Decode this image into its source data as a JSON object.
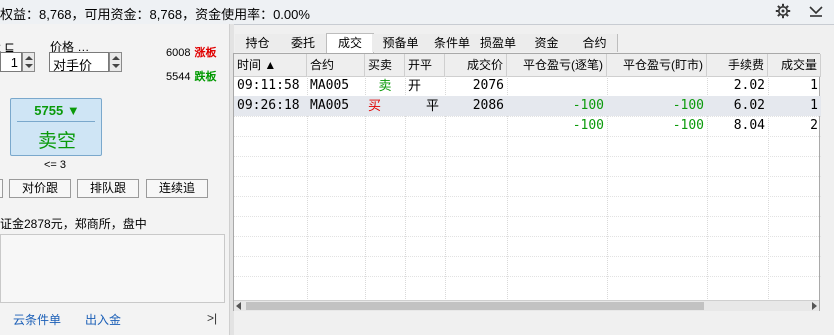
{
  "header": {
    "summary": "权益：8,768，可用资金：8,768，资金使用率：0.00%"
  },
  "order_panel": {
    "qty_label": "量 ⊑",
    "qty_value": "1",
    "price_label": "价格 …",
    "price_value": "对手价",
    "limit_up_price": "6008",
    "limit_up_label": "涨板",
    "limit_down_price": "5544",
    "limit_down_label": "跌板",
    "action_price": "5755 ▼",
    "action_label": "卖空",
    "max_qty": "<= 3",
    "buttons": [
      "对价跟",
      "排队跟",
      "连续追"
    ],
    "info": "证金2878元，郑商所，盘中",
    "links": [
      "云条件单",
      "出入金"
    ],
    "pager": ">|"
  },
  "tabs": [
    "持仓",
    "委托",
    "成交",
    "预备单",
    "条件单",
    "损盈单",
    "资金",
    "合约"
  ],
  "active_tab": "成交",
  "table": {
    "headers": [
      "时间 ▲",
      "合约",
      "买卖",
      "开平",
      "成交价",
      "平仓盈亏(逐笔)",
      "平仓盈亏(盯市)",
      "手续费",
      "成交量"
    ],
    "rows": [
      {
        "time": "09:11:58",
        "contract": "MA005",
        "side": "卖",
        "oc": "开",
        "price": "2076",
        "pnl_trade": "",
        "pnl_market": "",
        "fee": "2.02",
        "qty": "1"
      },
      {
        "time": "09:26:18",
        "contract": "MA005",
        "side": "买",
        "oc": "平",
        "price": "2086",
        "pnl_trade": "-100",
        "pnl_market": "-100",
        "fee": "6.02",
        "qty": "1"
      },
      {
        "time": "",
        "contract": "",
        "side": "",
        "oc": "",
        "price": "",
        "pnl_trade": "-100",
        "pnl_market": "-100",
        "fee": "8.04",
        "qty": "2"
      }
    ]
  },
  "colors": {
    "buy": "#e00000",
    "sell": "#0a9a0a",
    "loss": "#0a9a0a",
    "link": "#1b5fb7"
  }
}
